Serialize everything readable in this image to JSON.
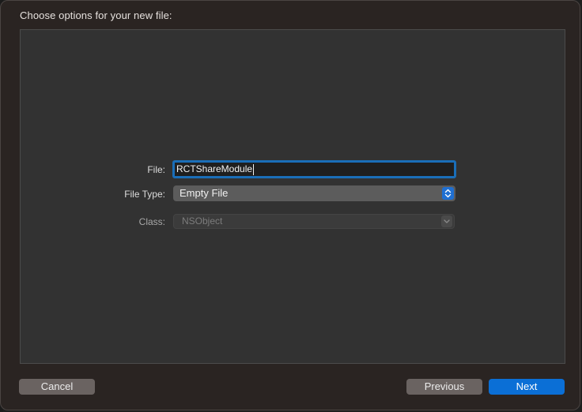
{
  "dialog": {
    "title": "Choose options for your new file:"
  },
  "form": {
    "file_label": "File:",
    "file_value": "RCTShareModule",
    "file_type_label": "File Type:",
    "file_type_value": "Empty File",
    "class_label": "Class:",
    "class_value": "NSObject"
  },
  "buttons": {
    "cancel": "Cancel",
    "previous": "Previous",
    "next": "Next"
  },
  "colors": {
    "accent": "#0b6fd6",
    "focus_ring": "#1a6eb8",
    "sheet_bg": "#2a2422",
    "panel_bg": "#323232"
  },
  "icons": {
    "file_type_stepper": "up-down-chevron-icon",
    "class_chevron": "chevron-down-icon"
  }
}
